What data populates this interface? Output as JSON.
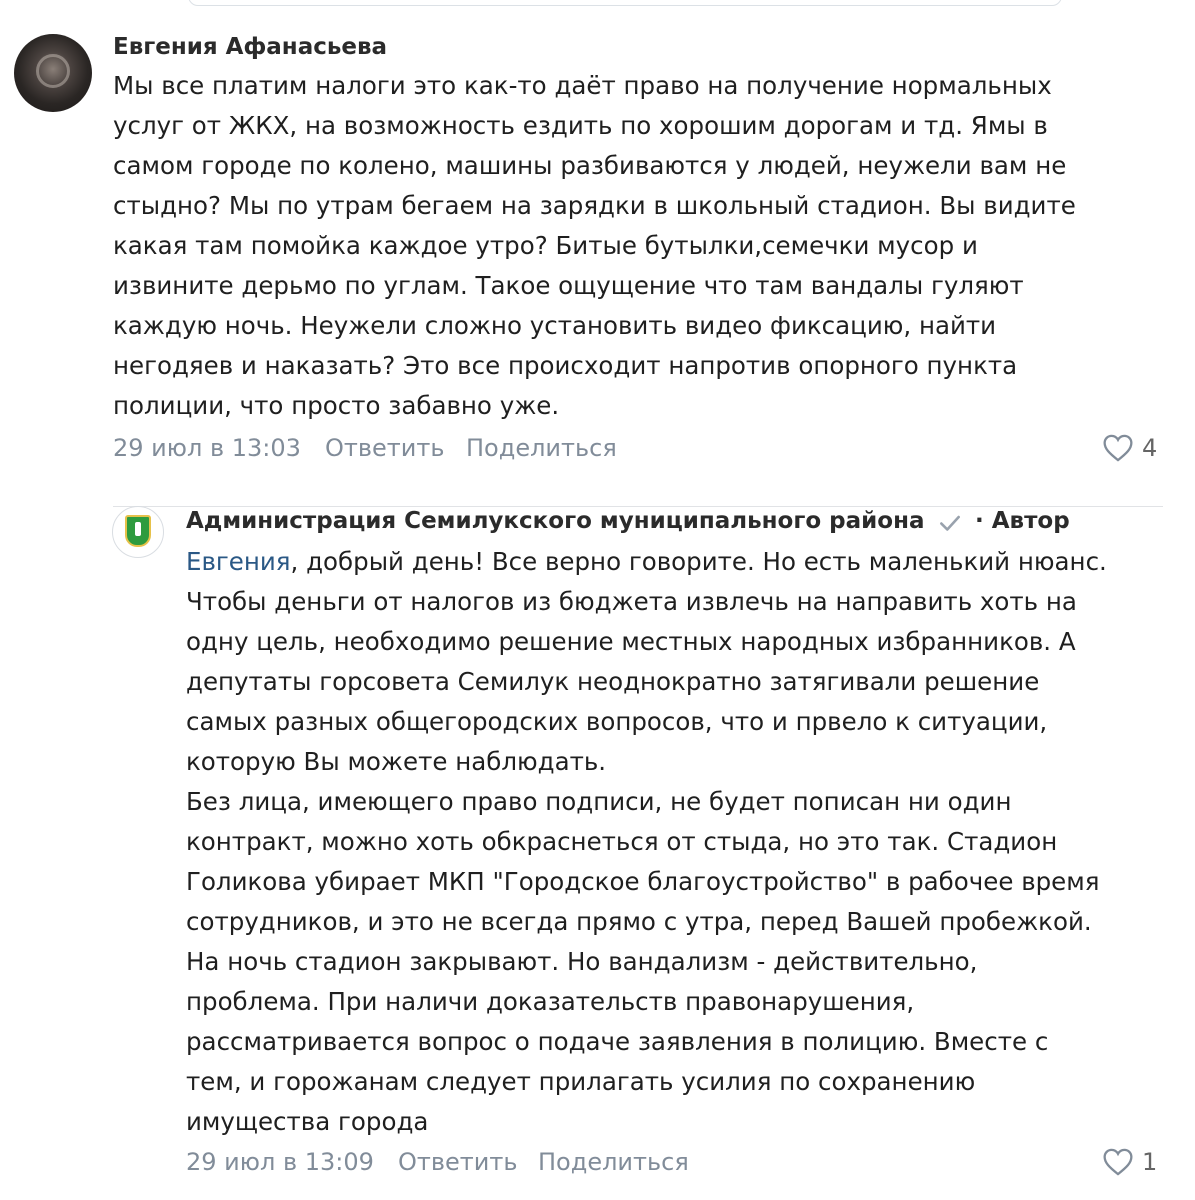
{
  "comments": [
    {
      "author": "Евгения Афанасьева",
      "text": "Мы все платим налоги это как-то даёт право на получение нормальных\nуслуг от ЖКХ, на возможность ездить по хорошим дорогам и тд. Ямы в\nсамом городе по колено, машины разбиваются у людей, неужели вам не\nстыдно? Мы по утрам бегаем на зарядки в школьный стадион. Вы видите\nкакая там помойка каждое утро? Битые бутылки,семечки мусор и\nизвините дерьмо по углам. Такое ощущение что там вандалы гуляют\nкаждую ночь. Неужели сложно установить видео фиксацию, найти\nнегодяев и наказать? Это все происходит напротив опорного пункта\nполиции, что просто забавно уже.",
      "date": "29 июл в 13:03",
      "reply_label": "Ответить",
      "share_label": "Поделиться",
      "likes": "4"
    },
    {
      "author": "Администрация Семилукского муниципального района",
      "author_tag": "· Автор",
      "mention": "Евгения",
      "text_after_mention": ", добрый день! Все верно говорите. Но есть маленький нюанс.\nЧтобы деньги от налогов из бюджета извлечь на направить хоть на\nодну цель, необходимо решение местных народных избранников. А\nдепутаты горсовета Семилук неоднократно затягивали решение\nсамых разных общегородских вопросов, что и првело к ситуации,\nкоторую Вы можете наблюдать.\nБез лица, имеющего право подписи, не будет пописан ни один\nконтракт, можно хоть обкраснеться от стыда, но это так. Стадион\nГоликова убирает МКП \"Городское благоустройство\" в рабочее время\nсотрудников, и это не всегда прямо с утра, перед Вашей пробежкой.\nНа ночь стадион закрывают. Но вандализм - действительно,\nпроблема. При наличи доказательств правонарушения,\nрассматривается вопрос о подаче заявления в полицию. Вместе с\nтем, и горожанам следует прилагать усилия по сохранению\nимущества города",
      "date": "29 июл в 13:09",
      "reply_label": "Ответить",
      "share_label": "Поделиться",
      "likes": "1"
    }
  ],
  "colors": {
    "link": "#2a5885",
    "meta": "#818c99",
    "verified": "#99a2ad"
  },
  "icons": [
    "avatar-photo",
    "avatar-coat-of-arms",
    "verified-check-icon",
    "heart-icon"
  ]
}
